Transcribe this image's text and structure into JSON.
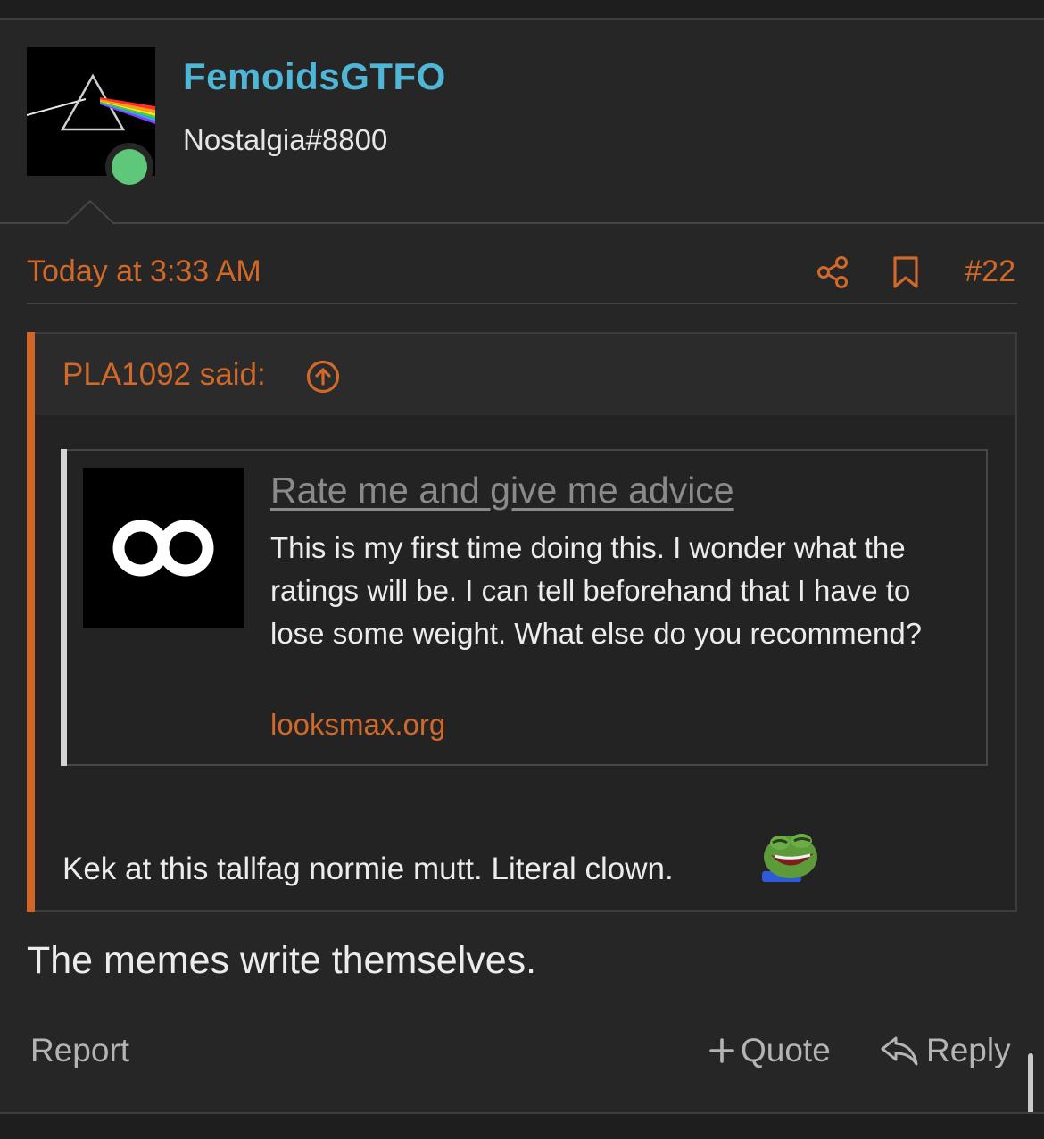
{
  "user": {
    "username": "FemoidsGTFO",
    "title": "Nostalgia#8800",
    "status_color": "#5ec77a",
    "username_color": "#4fb6d6"
  },
  "post": {
    "date": "Today at 3:33 AM",
    "number": "#22",
    "text": "The memes write themselves."
  },
  "quote": {
    "attribution": "PLA1092 said:",
    "text": "Kek at this tallfag normie mutt. Literal clown.",
    "emoji": "pepe-laugh-icon"
  },
  "unfurl": {
    "title": "Rate me and give me advice",
    "description": "This is my first time doing this. I wonder what the ratings will be. I can tell beforehand that I have to lose some weight. What else do you recommend?",
    "domain": "looksmax.org"
  },
  "actions": {
    "report": "Report",
    "quote": "Quote",
    "reply": "Reply"
  },
  "colors": {
    "accent": "#d0692a",
    "background": "#262626"
  }
}
